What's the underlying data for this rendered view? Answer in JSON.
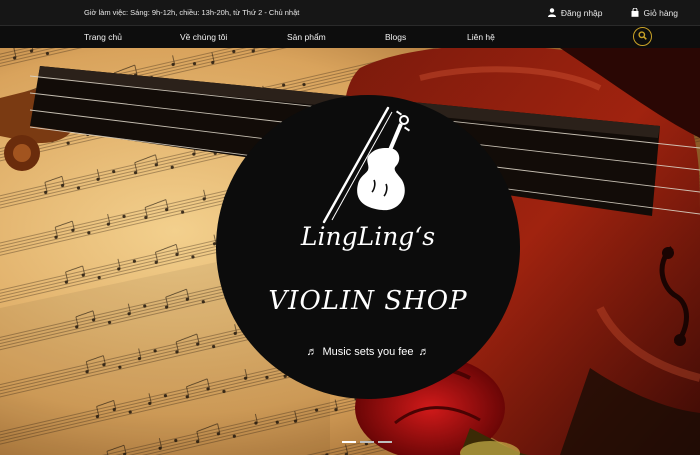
{
  "topbar": {
    "hours": "Giờ làm việc: Sáng: 9h-12h, chiều: 13h-20h, từ Thứ 2 - Chủ nhật",
    "login": "Đăng nhập",
    "cart": "Giỏ hàng"
  },
  "nav": {
    "items": [
      "Trang chủ",
      "Về chúng tôi",
      "Sản phẩm",
      "Blogs",
      "Liên hệ"
    ],
    "search_icon": "search-icon"
  },
  "hero": {
    "brand_line1": "LingLing‘s",
    "brand_line2": "VIOLIN SHOP",
    "slogan": "Music sets you fee",
    "slides": 3,
    "active_slide": 1
  },
  "colors": {
    "accent": "#c9a227",
    "topbar_bg": "#161616",
    "nav_bg": "#0d0d0d"
  }
}
